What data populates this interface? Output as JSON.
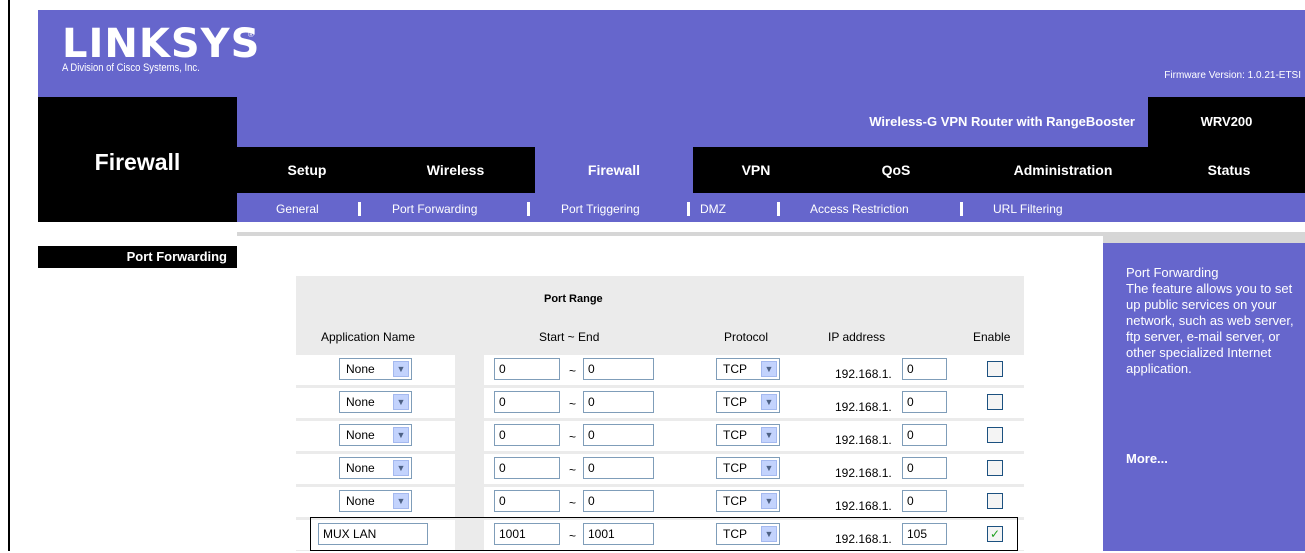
{
  "header": {
    "logo_text": "LINKSYS",
    "logo_reg": "®",
    "logo_subtitle": "A Division of Cisco Systems, Inc.",
    "firmware": "Firmware Version: 1.0.21-ETSI",
    "brand_color": "#6666cc"
  },
  "section_title": "Firewall",
  "product": {
    "name": "Wireless-G VPN Router with RangeBooster",
    "model": "WRV200"
  },
  "tabs": [
    {
      "label": "Setup"
    },
    {
      "label": "Wireless"
    },
    {
      "label": "Firewall",
      "active": true
    },
    {
      "label": "VPN"
    },
    {
      "label": "QoS"
    },
    {
      "label": "Administration"
    },
    {
      "label": "Status"
    }
  ],
  "subtabs": [
    {
      "label": "General"
    },
    {
      "label": "Port Forwarding"
    },
    {
      "label": "Port Triggering"
    },
    {
      "label": "DMZ"
    },
    {
      "label": "Access Restriction"
    },
    {
      "label": "URL Filtering"
    }
  ],
  "left_menu": {
    "active_item": "Port Forwarding"
  },
  "table": {
    "group_header": "Port Range",
    "headers": {
      "app": "Application Name",
      "range": "Start ~ End",
      "protocol": "Protocol",
      "ip": "IP address",
      "enable": "Enable"
    },
    "tilde": "~",
    "ip_prefix": "192.168.1.",
    "dropdown_arrow": "▼",
    "check_mark": "✓",
    "rows": [
      {
        "app": "None",
        "app_type": "select",
        "start": "0",
        "end": "0",
        "protocol": "TCP",
        "ip_last": "0",
        "enabled": false
      },
      {
        "app": "None",
        "app_type": "select",
        "start": "0",
        "end": "0",
        "protocol": "TCP",
        "ip_last": "0",
        "enabled": false
      },
      {
        "app": "None",
        "app_type": "select",
        "start": "0",
        "end": "0",
        "protocol": "TCP",
        "ip_last": "0",
        "enabled": false
      },
      {
        "app": "None",
        "app_type": "select",
        "start": "0",
        "end": "0",
        "protocol": "TCP",
        "ip_last": "0",
        "enabled": false
      },
      {
        "app": "None",
        "app_type": "select",
        "start": "0",
        "end": "0",
        "protocol": "TCP",
        "ip_last": "0",
        "enabled": false
      },
      {
        "app": "MUX LAN",
        "app_type": "text",
        "start": "1001",
        "end": "1001",
        "protocol": "TCP",
        "ip_last": "105",
        "enabled": true
      }
    ]
  },
  "help": {
    "title": "Port Forwarding",
    "body": "The feature allows you to set up public services on your network, such as web server, ftp server, e-mail server, or other specialized Internet application.",
    "more": "More..."
  }
}
